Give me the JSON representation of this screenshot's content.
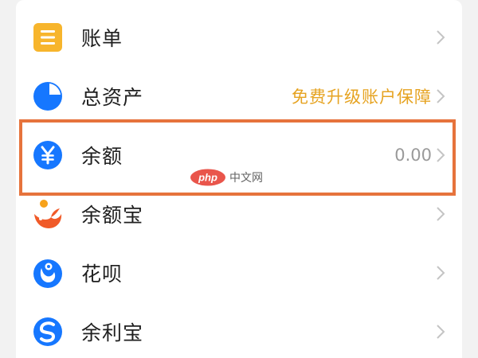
{
  "menu": {
    "items": [
      {
        "label": "账单",
        "icon": "bill-icon",
        "value": ""
      },
      {
        "label": "总资产",
        "icon": "pie-chart-icon",
        "value": "免费升级账户保障"
      },
      {
        "label": "余额",
        "icon": "yuan-coin-icon",
        "value": "0.00"
      },
      {
        "label": "余额宝",
        "icon": "yuebao-icon",
        "value": ""
      },
      {
        "label": "花呗",
        "icon": "huabei-icon",
        "value": ""
      },
      {
        "label": "余利宝",
        "icon": "yulibao-icon",
        "value": ""
      }
    ]
  },
  "highlight": {
    "target": "余额"
  },
  "watermark": {
    "text": "中文网",
    "logo_text": "php"
  },
  "colors": {
    "bill_orange": "#f7b52c",
    "blue": "#1677ff",
    "red_orange": "#f05a28",
    "promo_text": "#e6a321",
    "highlight_border": "#e6733c"
  }
}
